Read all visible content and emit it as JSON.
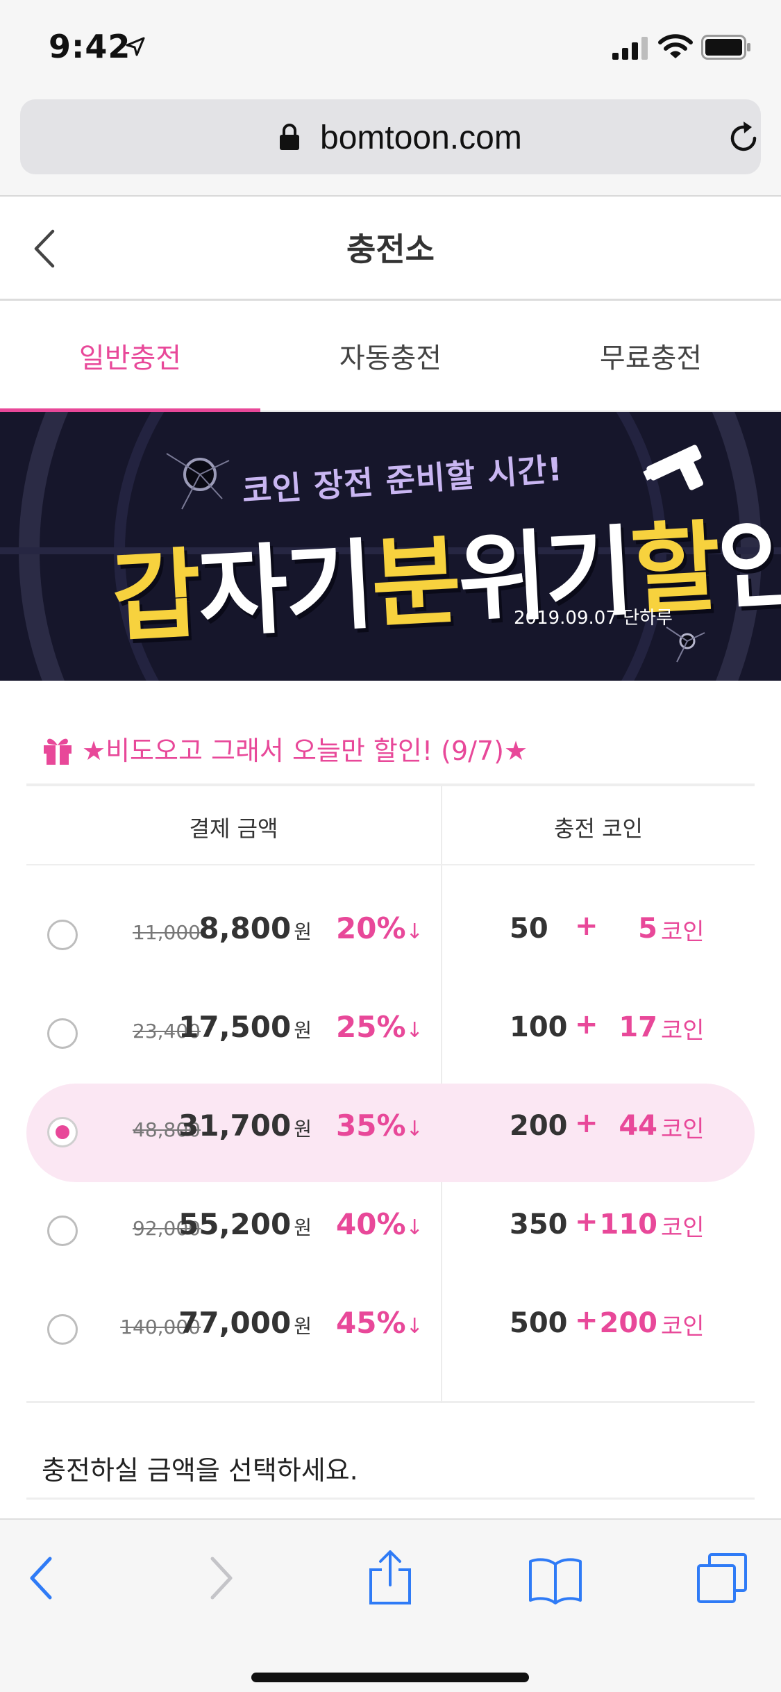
{
  "status": {
    "time": "9:42"
  },
  "browser": {
    "url": "bomtoon.com"
  },
  "header": {
    "title": "충전소"
  },
  "tabs": [
    {
      "label": "일반충전",
      "active": true
    },
    {
      "label": "자동충전",
      "active": false
    },
    {
      "label": "무료충전",
      "active": false
    }
  ],
  "banner": {
    "subtitle": "코인 장전 준비할 시간!",
    "title_parts": [
      "갑",
      "자기",
      "분",
      "위기",
      "할",
      "인"
    ],
    "date": "2019.09.07 단하루"
  },
  "promo": {
    "title": "★비도오고 그래서 오늘만 할인! (9/7)★"
  },
  "table": {
    "headers": [
      "결제 금액",
      "충전 코인"
    ],
    "rows": [
      {
        "original": "11,000",
        "price": "8,800",
        "currency": "원",
        "discount": "20%",
        "arrow": "↓",
        "base": "50",
        "plus": "+",
        "bonus": "5",
        "unit": "코인",
        "selected": false
      },
      {
        "original": "23,400",
        "price": "17,500",
        "currency": "원",
        "discount": "25%",
        "arrow": "↓",
        "base": "100",
        "plus": "+",
        "bonus": "17",
        "unit": "코인",
        "selected": false
      },
      {
        "original": "48,800",
        "price": "31,700",
        "currency": "원",
        "discount": "35%",
        "arrow": "↓",
        "base": "200",
        "plus": "+",
        "bonus": "44",
        "unit": "코인",
        "selected": true
      },
      {
        "original": "92,000",
        "price": "55,200",
        "currency": "원",
        "discount": "40%",
        "arrow": "↓",
        "base": "350",
        "plus": "+",
        "bonus": "110",
        "unit": "코인",
        "selected": false
      },
      {
        "original": "140,000",
        "price": "77,000",
        "currency": "원",
        "discount": "45%",
        "arrow": "↓",
        "base": "500",
        "plus": "+",
        "bonus": "200",
        "unit": "코인",
        "selected": false
      }
    ]
  },
  "hint": "충전하실 금액을 선택하세요.",
  "colors": {
    "accent": "#e84899",
    "selected_row": "#fbe7f3",
    "banner_bg": "#16162b",
    "banner_yellow": "#f7d23e"
  },
  "toolbar": {
    "icons": [
      "back-icon",
      "forward-icon",
      "share-icon",
      "bookmarks-icon",
      "tabs-icon"
    ]
  }
}
